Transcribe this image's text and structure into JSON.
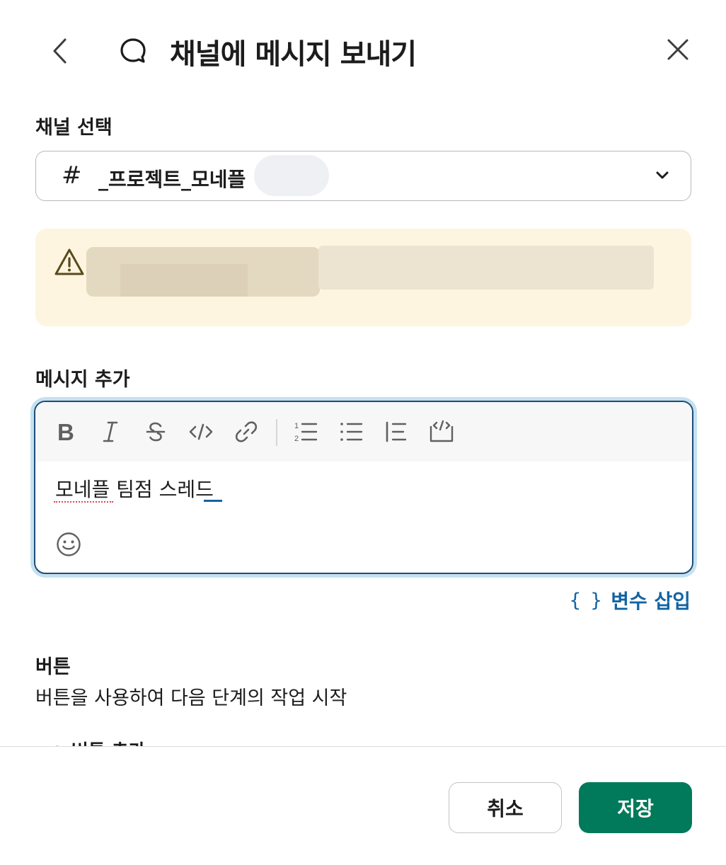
{
  "header": {
    "title": "채널에 메시지 보내기",
    "back_icon": "chevron-left-icon",
    "title_icon": "message-bubble-icon",
    "close_icon": "close-icon"
  },
  "channel": {
    "label": "채널 선택",
    "hash": "#",
    "selected_name": "_프로젝트_모네플"
  },
  "warning": {
    "icon": "warning-triangle-icon"
  },
  "message": {
    "label": "메시지 추가",
    "text": "모네플 팀점 스레드",
    "toolbar": [
      "bold-icon",
      "italic-icon",
      "strikethrough-icon",
      "code-icon",
      "link-icon",
      "ordered-list-icon",
      "bulleted-list-icon",
      "blockquote-icon",
      "code-block-icon"
    ],
    "emoji_icon": "emoji-icon"
  },
  "insert_variable": {
    "braces": "{ }",
    "label": "변수 삽입"
  },
  "buttons_section": {
    "title": "버튼",
    "description": "버튼을 사용하여 다음 단계의 작업 시작",
    "add_label": "+ 버튼 추가"
  },
  "footer": {
    "cancel_label": "취소",
    "save_label": "저장"
  },
  "colors": {
    "primary": "#007a5a",
    "link": "#1264a3",
    "focus_ring": "#c5e1f0",
    "warning_bg": "#fdf5e0"
  }
}
